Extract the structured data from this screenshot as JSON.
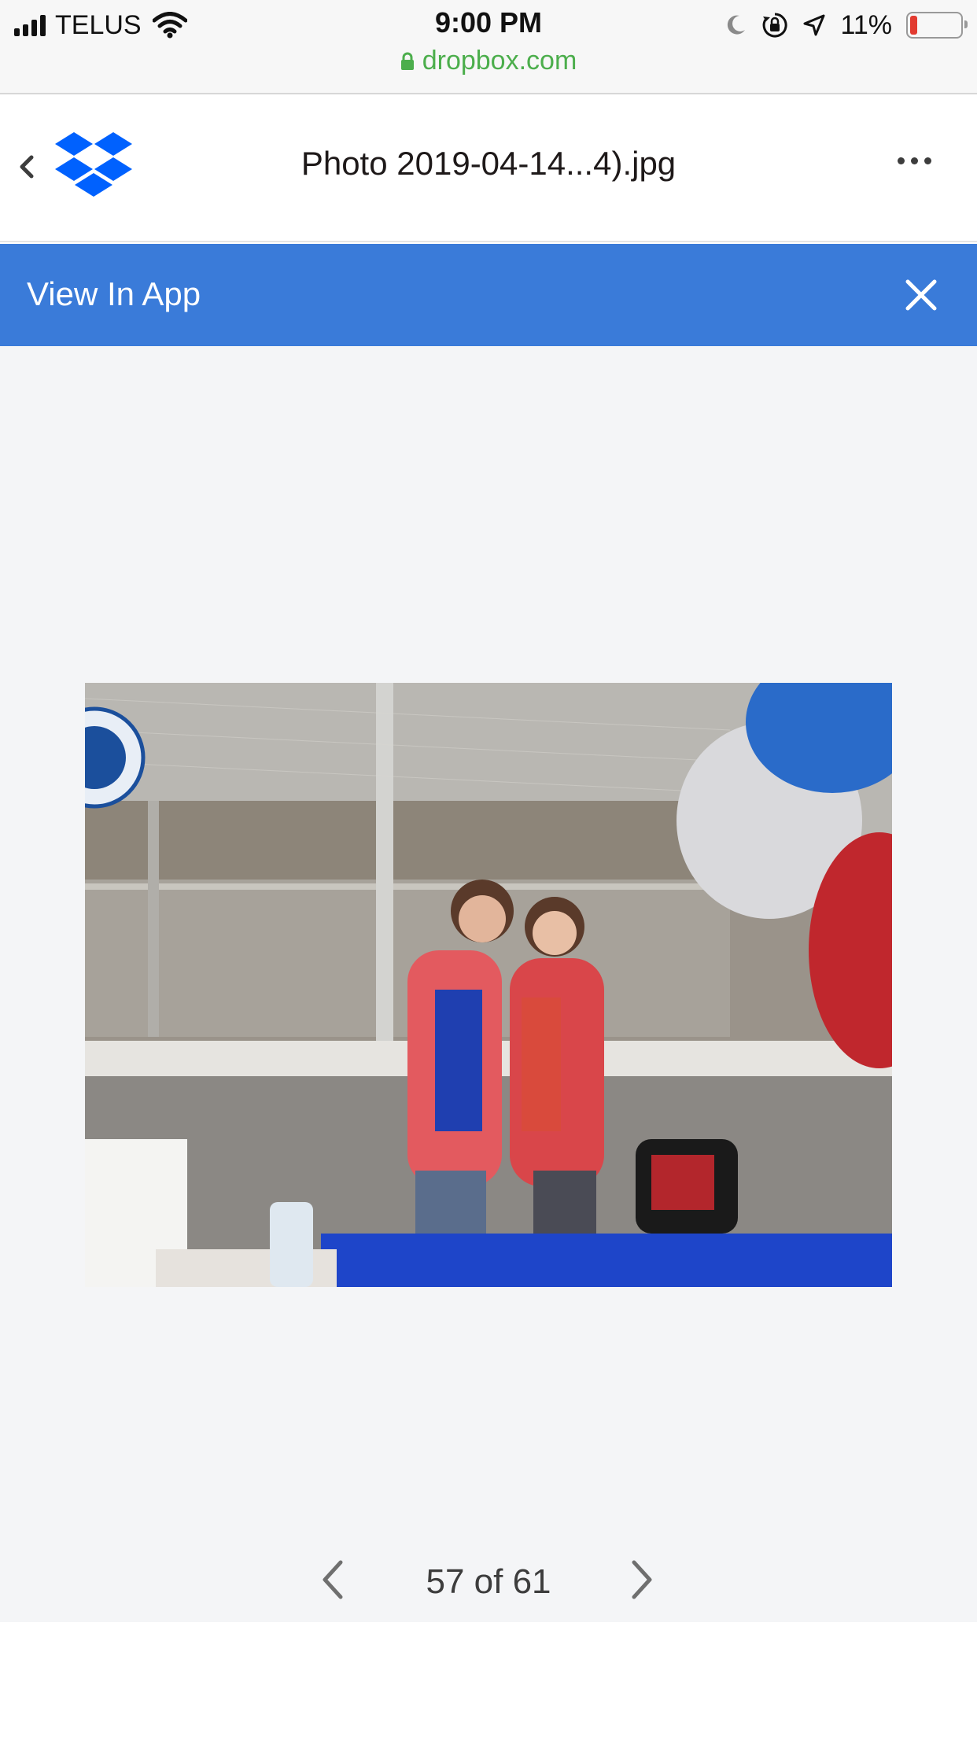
{
  "status_bar": {
    "carrier": "TELUS",
    "time": "9:00 PM",
    "url": "dropbox.com",
    "battery_percent": "11%",
    "battery_level": 0.11
  },
  "header": {
    "file_title": "Photo 2019-04-14...4).jpg",
    "back_icon": "chevron-left-icon",
    "logo": "dropbox-logo",
    "more_icon": "ellipsis-icon"
  },
  "banner": {
    "label": "View In App",
    "close_icon": "close-icon",
    "color": "#3a7bd9"
  },
  "viewer": {
    "photo_alt": "photo",
    "pager": {
      "label": "57 of 61",
      "prev_icon": "chevron-left-icon",
      "next_icon": "chevron-right-icon"
    }
  },
  "colors": {
    "dropbox_blue": "#0061fe",
    "url_green": "#4cae4c",
    "battery_red": "#e23b30",
    "viewer_bg": "#f4f5f7"
  }
}
